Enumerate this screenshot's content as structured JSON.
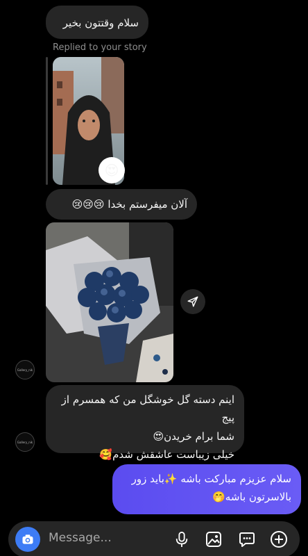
{
  "messages": {
    "m1_text": "سلام وقتتون بخیر",
    "reply_label": "Replied to your story",
    "story_reaction": "😍",
    "m2_text": "آلان میفرستم بخدا 😢😢😢",
    "m3_line1": "اینم دسته گل خوشگل من که همسرم از پیج",
    "m3_line2": "شما برام خریدن😍",
    "m3_line3": "خیلی زیباست عاشقش شدم🥰",
    "m4_line1": "سلام عزیزم مبارکت باشه ✨باید زور",
    "m4_line2": "بالاسرتون باشه🤭"
  },
  "avatar_label": "Gallery_nik",
  "composer": {
    "placeholder": "Message..."
  },
  "colors": {
    "incoming_bubble": "#262626",
    "outgoing_bubble": "#5b4cf0",
    "camera_button": "#3d7cf5"
  }
}
